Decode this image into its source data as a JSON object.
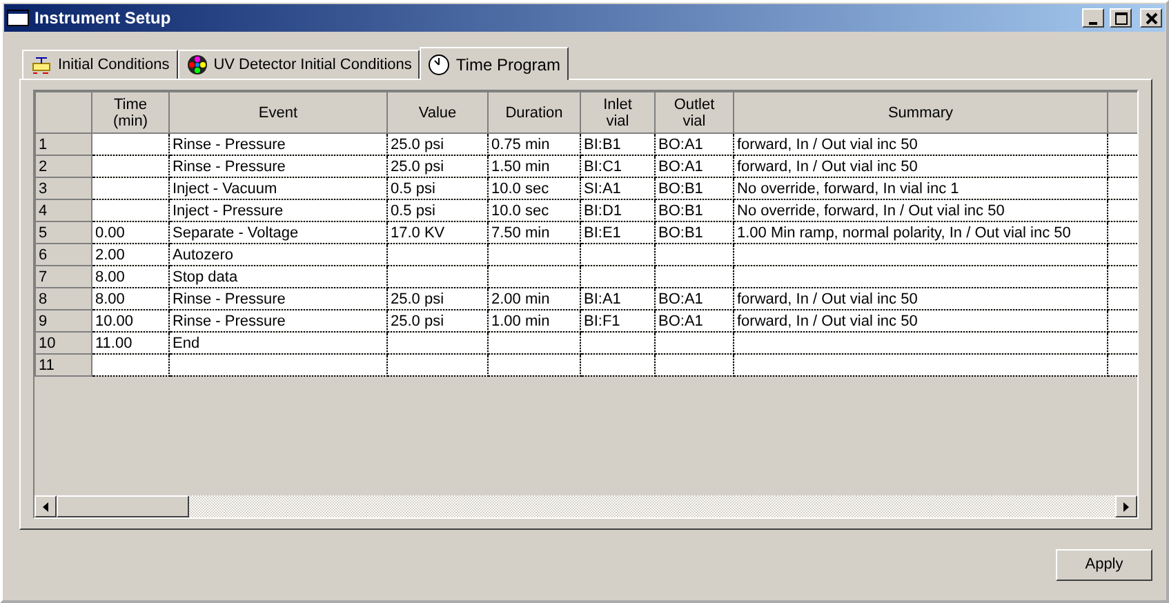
{
  "window": {
    "title": "Instrument Setup"
  },
  "tabs": [
    {
      "label": "Initial Conditions",
      "selected": false,
      "kind": "instrument"
    },
    {
      "label": "UV Detector Initial Conditions",
      "selected": false,
      "kind": "detector"
    },
    {
      "label": "Time Program",
      "selected": true,
      "kind": "clock"
    }
  ],
  "table": {
    "columns": [
      "Time (min)",
      "Event",
      "Value",
      "Duration",
      "Inlet vial",
      "Outlet vial",
      "Summary"
    ],
    "rows": [
      {
        "number": "1",
        "event": "Rinse - Pressure",
        "value": "25.0 psi",
        "duration": "0.75 min",
        "inlet_vial": "BI:B1",
        "outlet_vial": "BO:A1",
        "summary": "forward, In / Out vial inc 50"
      },
      {
        "number": "2",
        "event": "Rinse - Pressure",
        "value": "25.0 psi",
        "duration": "1.50 min",
        "inlet_vial": "BI:C1",
        "outlet_vial": "BO:A1",
        "summary": "forward, In / Out vial inc 50"
      },
      {
        "number": "3",
        "event": "Inject - Vacuum",
        "value": "0.5 psi",
        "duration": "10.0 sec",
        "inlet_vial": "SI:A1",
        "outlet_vial": "BO:B1",
        "summary": "No override, forward, In vial inc 1"
      },
      {
        "number": "4",
        "event": "Inject - Pressure",
        "value": "0.5 psi",
        "duration": "10.0 sec",
        "inlet_vial": "BI:D1",
        "outlet_vial": "BO:B1",
        "summary": "No override, forward, In / Out vial inc 50"
      },
      {
        "number": "5",
        "time": "0.00",
        "event": "Separate - Voltage",
        "value": "17.0 KV",
        "duration": "7.50 min",
        "inlet_vial": "BI:E1",
        "outlet_vial": "BO:B1",
        "summary": "1.00 Min ramp, normal polarity, In / Out vial inc 50"
      },
      {
        "number": "6",
        "time": "2.00",
        "event": "Autozero"
      },
      {
        "number": "7",
        "time": "8.00",
        "event": "Stop data"
      },
      {
        "number": "8",
        "time": "8.00",
        "event": "Rinse - Pressure",
        "value": "25.0 psi",
        "duration": "2.00 min",
        "inlet_vial": "BI:A1",
        "outlet_vial": "BO:A1",
        "summary": "forward, In / Out vial inc 50"
      },
      {
        "number": "9",
        "time": "10.00",
        "event": "Rinse - Pressure",
        "value": "25.0 psi",
        "duration": "1.00 min",
        "inlet_vial": "BI:F1",
        "outlet_vial": "BO:A1",
        "summary": "forward, In / Out vial inc 50"
      },
      {
        "number": "10",
        "time": "11.00",
        "event": "End"
      },
      {
        "number": "11"
      }
    ]
  },
  "buttons": [
    {
      "label": "Apply"
    }
  ]
}
